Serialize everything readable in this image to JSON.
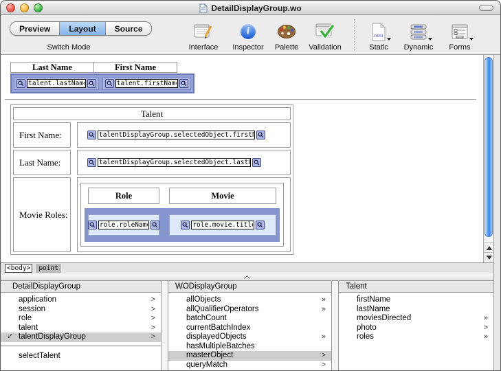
{
  "window": {
    "title": "DetailDisplayGroup.wo"
  },
  "toolbar": {
    "switch_mode": {
      "segments": [
        "Preview",
        "Layout",
        "Source"
      ],
      "selected": "Layout",
      "caption": "Switch Mode"
    },
    "items": [
      {
        "label": "Interface",
        "icon": "window-pencil-icon"
      },
      {
        "label": "Inspector",
        "icon": "info-circle-icon"
      },
      {
        "label": "Palette",
        "icon": "artist-palette-icon"
      },
      {
        "label": "Validation",
        "icon": "window-checkmark-icon"
      },
      {
        "label": "Static",
        "icon": "html-document-icon",
        "has_dropdown": true
      },
      {
        "label": "Dynamic",
        "icon": "stacked-elements-icon",
        "has_dropdown": true
      },
      {
        "label": "Forms",
        "icon": "form-window-icon",
        "has_dropdown": true
      }
    ]
  },
  "editor": {
    "rep_table": {
      "headers": [
        "Last Name",
        "First Name"
      ],
      "bindings": [
        "talent.lastName",
        "talent.firstName"
      ]
    },
    "form_table": {
      "title": "Talent",
      "rows": [
        {
          "label": "First Name:",
          "binding": "talentDisplayGroup.selectedObject.firstName"
        },
        {
          "label": "Last Name:",
          "binding": "talentDisplayGroup.selectedObject.lastName"
        }
      ],
      "roles_row": {
        "label": "Movie Roles:",
        "headers": [
          "Role",
          "Movie"
        ],
        "bindings": [
          "role.roleName",
          "role.movie.title"
        ]
      }
    },
    "path_bar": {
      "element": "<body>",
      "cursor": "point"
    }
  },
  "panel": {
    "columns": [
      {
        "title": "DetailDisplayGroup",
        "items": [
          {
            "label": "application",
            "arrow": ">"
          },
          {
            "label": "session",
            "arrow": ">"
          },
          {
            "label": "role",
            "arrow": ">"
          },
          {
            "label": "talent",
            "arrow": ">"
          },
          {
            "label": "talentDisplayGroup",
            "arrow": ">",
            "check": "✓"
          }
        ],
        "actions": [
          {
            "label": "selectTalent",
            "arrow": ""
          }
        ]
      },
      {
        "title": "WODisplayGroup",
        "items": [
          {
            "label": "allObjects",
            "arrow": "»"
          },
          {
            "label": "allQualifierOperators",
            "arrow": "»"
          },
          {
            "label": "batchCount",
            "arrow": ""
          },
          {
            "label": "currentBatchIndex",
            "arrow": ""
          },
          {
            "label": "displayedObjects",
            "arrow": "»"
          },
          {
            "label": "hasMultipleBatches",
            "arrow": ""
          },
          {
            "label": "masterObject",
            "arrow": ">"
          },
          {
            "label": "queryMatch",
            "arrow": ">"
          }
        ]
      },
      {
        "title": "Talent",
        "items": [
          {
            "label": "firstName",
            "arrow": ""
          },
          {
            "label": "lastName",
            "arrow": ""
          },
          {
            "label": "moviesDirected",
            "arrow": "»"
          },
          {
            "label": "photo",
            "arrow": ">"
          },
          {
            "label": "roles",
            "arrow": "»"
          }
        ]
      }
    ]
  },
  "colors": {
    "selection_band": "#8494cc",
    "selected_cell": "#a9b3e2",
    "nested_cell": "#dfe9fc",
    "row_highlight": "#cdcdcd",
    "segment_selected": "#84b3ea",
    "aqua_scrollbar": "#3b82e6"
  }
}
